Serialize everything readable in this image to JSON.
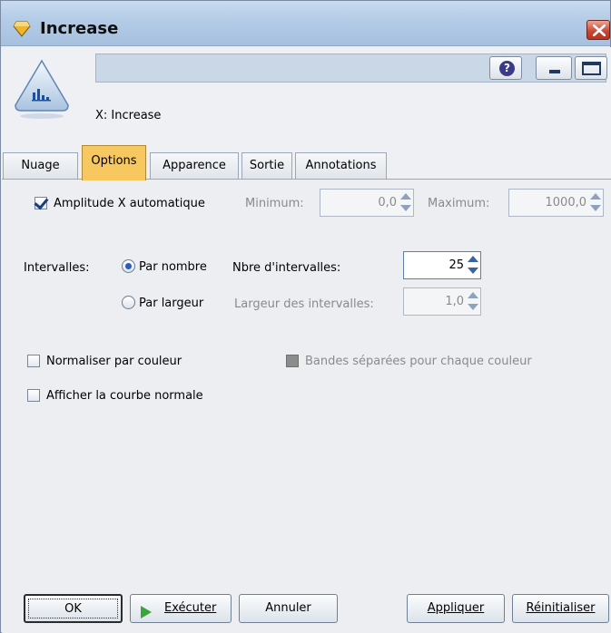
{
  "window": {
    "title": "Increase",
    "close_icon": "close-icon"
  },
  "header": {
    "node_name": "",
    "field_label": "X: Increase",
    "icons": [
      "histogram-node-icon",
      "help-icon",
      "minimize-icon",
      "maximize-icon"
    ]
  },
  "tabs": [
    {
      "label": "Nuage",
      "active": false
    },
    {
      "label": "Options",
      "active": true
    },
    {
      "label": "Apparence",
      "active": false
    },
    {
      "label": "Sortie",
      "active": false
    },
    {
      "label": "Annotations",
      "active": false
    }
  ],
  "options": {
    "auto_range": {
      "label": "Amplitude X automatique",
      "checked": true
    },
    "minimum": {
      "label": "Minimum:",
      "value": "0,0"
    },
    "maximum": {
      "label": "Maximum:",
      "value": "1000,0"
    },
    "bins_label": "Intervalles:",
    "by_number": {
      "label": "Par nombre",
      "selected": true
    },
    "bin_count": {
      "label": "Nbre d'intervalles:",
      "value": "25"
    },
    "by_width": {
      "label": "Par largeur",
      "selected": false
    },
    "bin_width": {
      "label": "Largeur des intervalles:",
      "value": "1,0"
    },
    "normalize": {
      "label": "Normaliser par couleur",
      "checked": false
    },
    "separate_bands": {
      "label": "Bandes séparées pour chaque couleur",
      "checked": false,
      "disabled": true
    },
    "normal_curve": {
      "label": "Afficher la courbe normale",
      "checked": false
    }
  },
  "footer": {
    "ok": "OK",
    "run": "Exécuter",
    "cancel": "Annuler",
    "apply": "Appliquer",
    "reset": "Réinitialiser"
  },
  "colors": {
    "active_tab": "#f7c760",
    "run_arrow": "#3aa53a",
    "close_button": "#c8442e"
  }
}
